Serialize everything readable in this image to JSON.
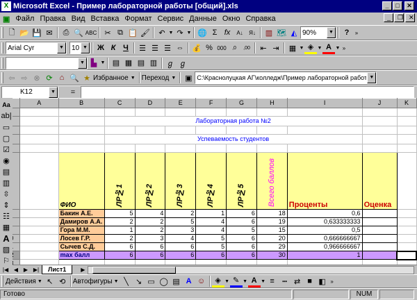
{
  "window": {
    "title": "Microsoft Excel - Пример лабораторной работы [общий].xls"
  },
  "menu": [
    "Файл",
    "Правка",
    "Вид",
    "Вставка",
    "Формат",
    "Сервис",
    "Данные",
    "Окно",
    "Справка"
  ],
  "toolbar": {
    "zoom": "90%",
    "font": "Arial Cyr",
    "size": "10"
  },
  "webbar": {
    "favorites": "Избранное",
    "go": "Переход",
    "path": "C:\\Краснолуцкая АГ\\колледж\\Пример лабораторной работы ("
  },
  "formula": {
    "cell_ref": "K12",
    "eq": "=",
    "content": ""
  },
  "columns": [
    "A",
    "B",
    "C",
    "D",
    "E",
    "F",
    "G",
    "H",
    "I",
    "J",
    "K"
  ],
  "rows": [
    "1",
    "2",
    "3",
    "4",
    "5",
    "6",
    "7",
    "8",
    "9",
    "10",
    "11",
    "12",
    "13",
    "14"
  ],
  "sheet": {
    "title1": "Лабораторная работа №2",
    "title2": "Успеваемость студентов",
    "headers": {
      "fio": "ФИО",
      "lr1": "ЛР№1",
      "lr2": "ЛР№2",
      "lr3": "ЛР№3",
      "lr4": "ЛР№4",
      "lr5": "ЛР№5",
      "total": "Всего баллов",
      "percent": "Проценты",
      "grade": "Оценка"
    },
    "students": [
      {
        "name": "Бакин А.Е.",
        "lr1": "5",
        "lr2": "4",
        "lr3": "2",
        "lr4": "1",
        "lr5": "6",
        "total": "18",
        "percent": "0,6"
      },
      {
        "name": "Дамиров А.А.",
        "lr1": "2",
        "lr2": "2",
        "lr3": "5",
        "lr4": "4",
        "lr5": "6",
        "total": "19",
        "percent": "0,633333333"
      },
      {
        "name": "Гора М.М.",
        "lr1": "1",
        "lr2": "2",
        "lr3": "3",
        "lr4": "4",
        "lr5": "5",
        "total": "15",
        "percent": "0,5"
      },
      {
        "name": "Лосев Г.Р.",
        "lr1": "2",
        "lr2": "3",
        "lr3": "4",
        "lr4": "5",
        "lr5": "6",
        "total": "20",
        "percent": "0,666666667"
      },
      {
        "name": "Сычев С.Д.",
        "lr1": "6",
        "lr2": "6",
        "lr3": "6",
        "lr4": "5",
        "lr5": "6",
        "total": "29",
        "percent": "0,966666667"
      }
    ],
    "max": {
      "name": "max балл",
      "lr1": "6",
      "lr2": "6",
      "lr3": "6",
      "lr4": "6",
      "lr5": "6",
      "total": "30",
      "percent": "1"
    }
  },
  "tabs": {
    "active": "Лист1"
  },
  "drawbar": {
    "actions": "Действия",
    "autoshapes": "Автофигуры"
  },
  "status": {
    "ready": "Готово",
    "num": "NUM"
  },
  "colors": {
    "titlebar": "#000080",
    "header_fill": "#ffff99",
    "name_fill": "#ffcc99",
    "max_fill": "#cc99ff",
    "title_text": "#0000ff",
    "header_text": "#ff00ff",
    "red_header": "#cc0000"
  }
}
